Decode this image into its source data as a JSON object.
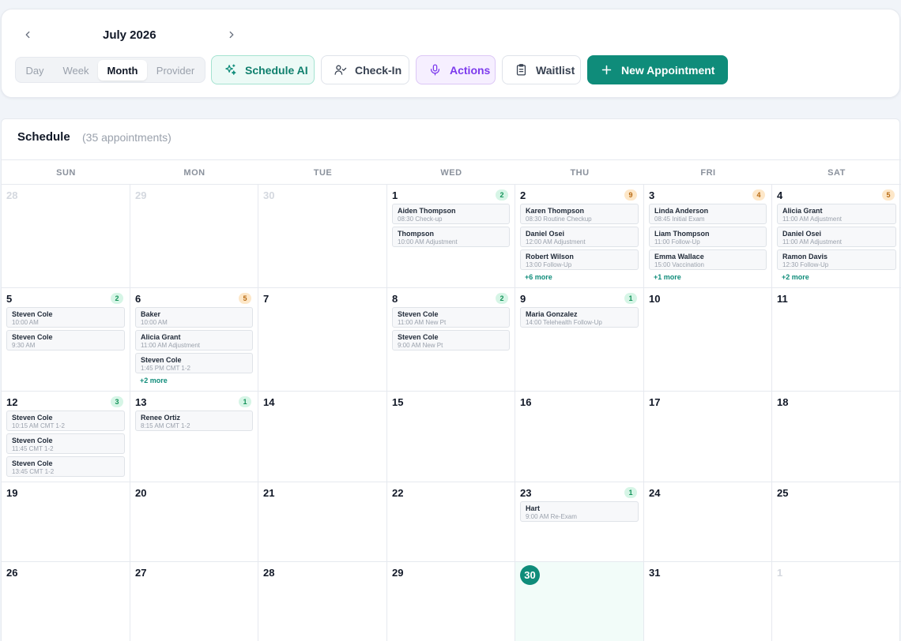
{
  "header": {
    "month_label": "July 2026",
    "views": [
      "Day",
      "Week",
      "Month",
      "Provider"
    ],
    "active_view": "Month",
    "buttons": {
      "schedule_ai": "Schedule AI",
      "check_in": "Check-In",
      "actions": "Actions",
      "waitlist": "Waitlist",
      "new_appointment": "New Appointment"
    }
  },
  "schedule": {
    "title": "Schedule",
    "count_text": "(35 appointments)",
    "days_of_week": [
      "SUN",
      "MON",
      "TUE",
      "WED",
      "THU",
      "FRI",
      "SAT"
    ],
    "today": 30,
    "weeks": [
      [
        {
          "day": "28",
          "faded": true
        },
        {
          "day": "29",
          "faded": true
        },
        {
          "day": "30",
          "faded": true
        },
        {
          "day": "1",
          "badge": "2",
          "badge_color": "green",
          "appts": [
            {
              "name": "Aiden Thompson",
              "detail": "08:30 Check-up"
            },
            {
              "name": "Thompson",
              "detail": "10:00 AM Adjustment"
            }
          ]
        },
        {
          "day": "2",
          "badge": "9",
          "badge_color": "orange",
          "appts": [
            {
              "name": "Karen Thompson",
              "detail": "08:30 Routine Checkup"
            },
            {
              "name": "Daniel Osei",
              "detail": "12:00 AM Adjustment"
            },
            {
              "name": "Robert Wilson",
              "detail": "13:00 Follow-Up"
            }
          ],
          "more": "+6 more"
        },
        {
          "day": "3",
          "badge": "4",
          "badge_color": "orange",
          "appts": [
            {
              "name": "Linda Anderson",
              "detail": "08:45 Initial Exam"
            },
            {
              "name": "Liam Thompson",
              "detail": "11:00 Follow-Up"
            },
            {
              "name": "Emma Wallace",
              "detail": "15:00 Vaccination"
            }
          ],
          "more": "+1 more"
        },
        {
          "day": "4",
          "badge": "5",
          "badge_color": "orange",
          "appts": [
            {
              "name": "Alicia Grant",
              "detail": "11:00 AM Adjustment"
            },
            {
              "name": "Daniel Osei",
              "detail": "11:00 AM Adjustment"
            },
            {
              "name": "Ramon Davis",
              "detail": "12:30 Follow-Up"
            }
          ],
          "more": "+2 more"
        }
      ],
      [
        {
          "day": "5",
          "badge": "2",
          "badge_color": "green",
          "appts": [
            {
              "name": "Steven Cole",
              "detail": "10:00 AM"
            },
            {
              "name": "Steven Cole",
              "detail": "9:30 AM"
            }
          ]
        },
        {
          "day": "6",
          "badge": "5",
          "badge_color": "orange",
          "appts": [
            {
              "name": "Baker",
              "detail": "10:00 AM"
            },
            {
              "name": "Alicia Grant",
              "detail": "11:00 AM Adjustment"
            },
            {
              "name": "Steven Cole",
              "detail": "1:45 PM CMT 1-2"
            }
          ],
          "more": "+2 more"
        },
        {
          "day": "7"
        },
        {
          "day": "8",
          "badge": "2",
          "badge_color": "green",
          "appts": [
            {
              "name": "Steven Cole",
              "detail": "11:00 AM New Pt"
            },
            {
              "name": "Steven Cole",
              "detail": "9:00 AM New Pt"
            }
          ]
        },
        {
          "day": "9",
          "badge": "1",
          "badge_color": "green",
          "appts": [
            {
              "name": "Maria Gonzalez",
              "detail": "14:00 Telehealth Follow-Up"
            }
          ]
        },
        {
          "day": "10"
        },
        {
          "day": "11"
        }
      ],
      [
        {
          "day": "12",
          "badge": "3",
          "badge_color": "green",
          "appts": [
            {
              "name": "Steven Cole",
              "detail": "10:15 AM CMT 1-2"
            },
            {
              "name": "Steven Cole",
              "detail": "11:45 CMT 1-2"
            },
            {
              "name": "Steven Cole",
              "detail": "13:45 CMT 1-2"
            }
          ]
        },
        {
          "day": "13",
          "badge": "1",
          "badge_color": "green",
          "appts": [
            {
              "name": "Renee Ortiz",
              "detail": "8:15 AM CMT 1-2"
            }
          ]
        },
        {
          "day": "14"
        },
        {
          "day": "15"
        },
        {
          "day": "16"
        },
        {
          "day": "17"
        },
        {
          "day": "18"
        }
      ],
      [
        {
          "day": "19"
        },
        {
          "day": "20"
        },
        {
          "day": "21"
        },
        {
          "day": "22"
        },
        {
          "day": "23",
          "badge": "1",
          "badge_color": "green",
          "appts": [
            {
              "name": "Hart",
              "detail": "9:00 AM Re-Exam"
            }
          ]
        },
        {
          "day": "24"
        },
        {
          "day": "25"
        }
      ],
      [
        {
          "day": "26"
        },
        {
          "day": "27"
        },
        {
          "day": "28"
        },
        {
          "day": "29"
        },
        {
          "day": "30",
          "today": true
        },
        {
          "day": "31"
        },
        {
          "day": "1",
          "faded": true
        }
      ]
    ]
  },
  "colors": {
    "accent": "#0f8c7a",
    "badge_green": "#d6f5e6",
    "badge_orange": "#fde7c8"
  }
}
